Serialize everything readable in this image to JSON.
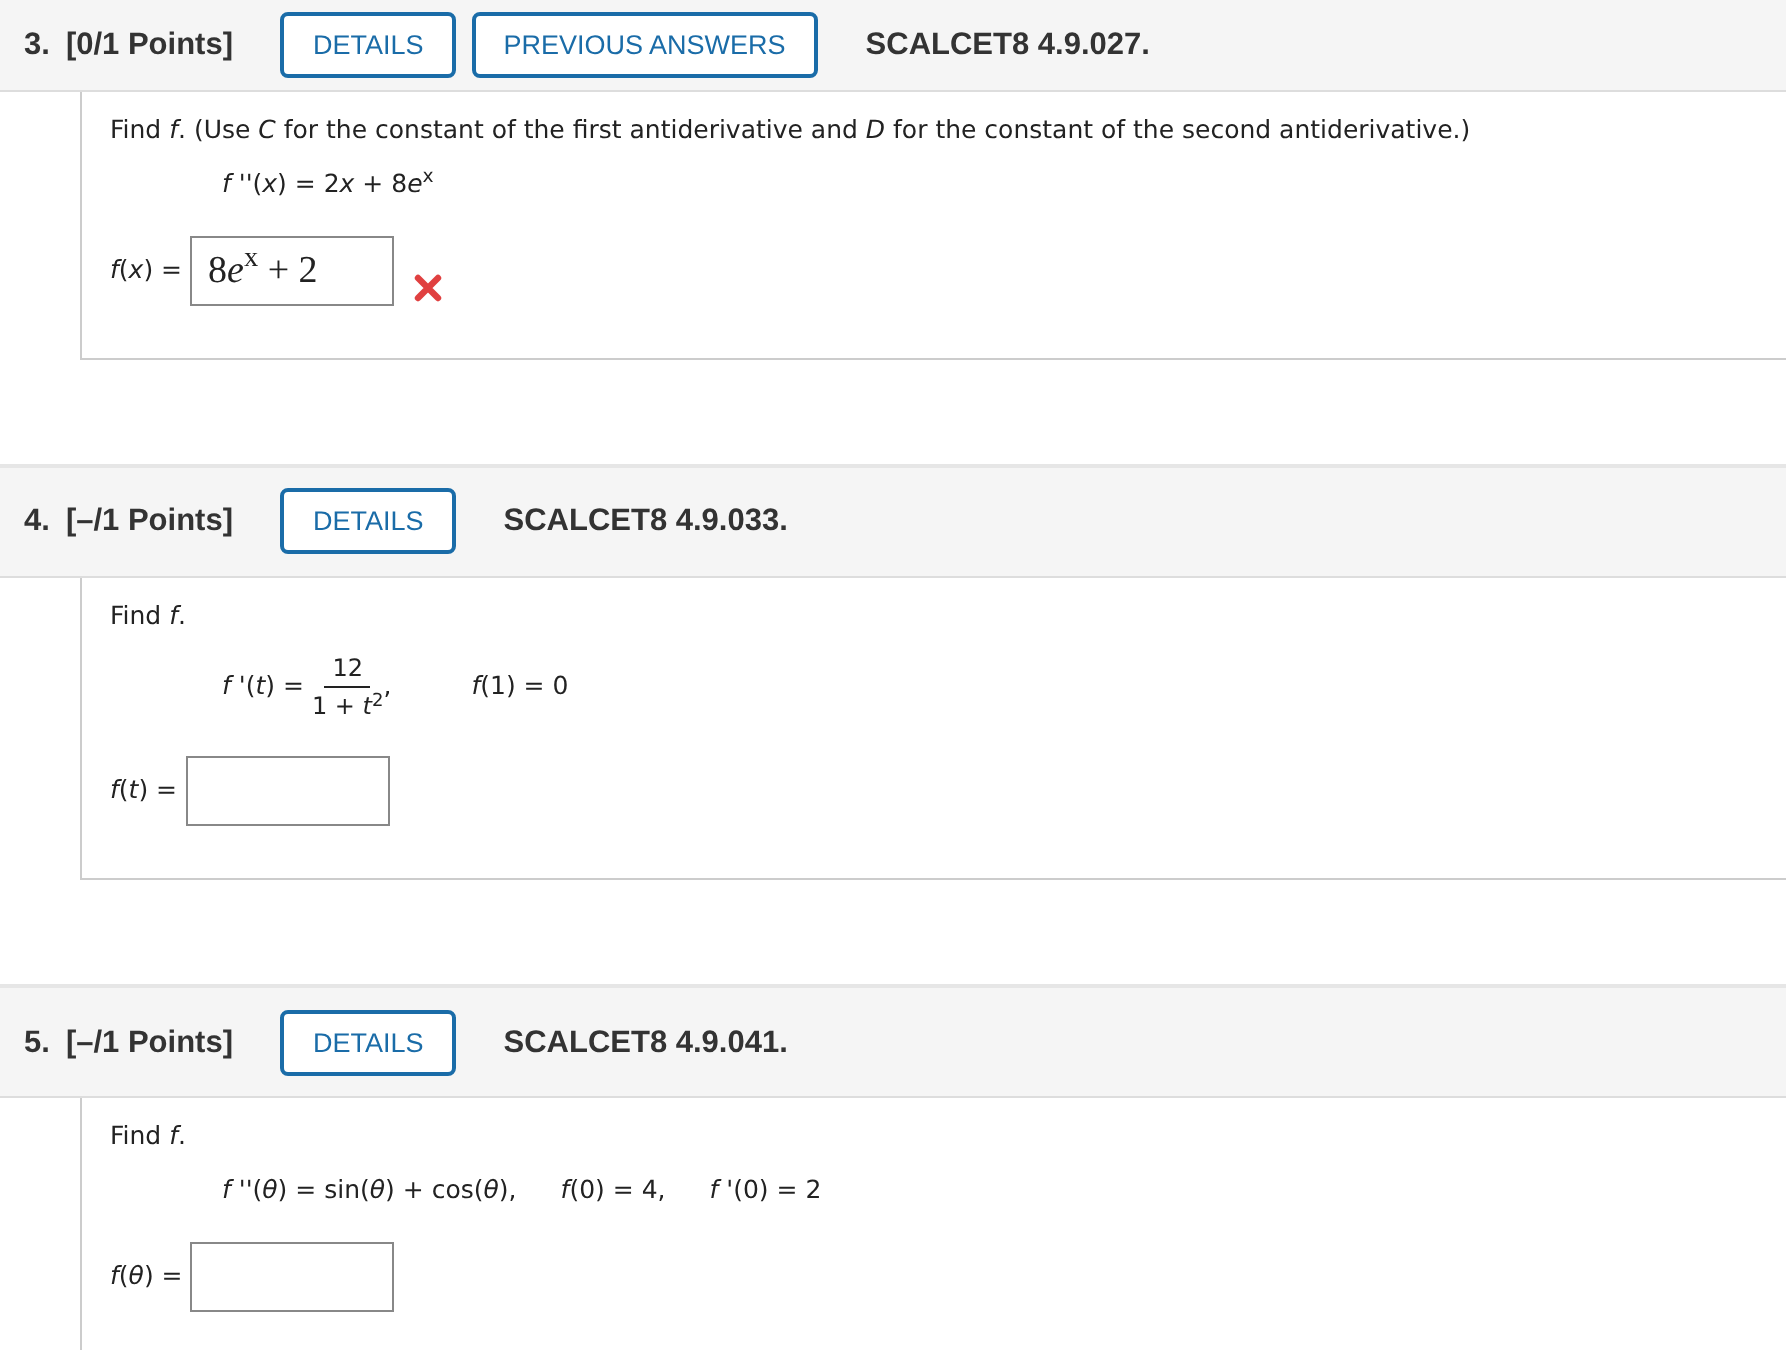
{
  "questions": [
    {
      "number": "3.",
      "points": "[0/1 Points]",
      "buttons": [
        "DETAILS",
        "PREVIOUS ANSWERS"
      ],
      "code": "SCALCET8 4.9.027.",
      "prompt": "Find *f*. (Use *C* for the constant of the first antiderivative and *D* for the constant of the second antiderivative.)",
      "given": [
        {
          "kind": "text",
          "text": [
            "*f* ''(*x*) = 2",
            "*x*",
            " + 8",
            "*e*",
            "$^{x}$"
          ]
        }
      ],
      "answer_label": [
        "*f*(*x*) ="
      ],
      "answer_value": [
        "8",
        "*e*",
        "$^{x}$",
        " + 2"
      ],
      "incorrect": true
    },
    {
      "number": "4.",
      "points": "[–/1 Points]",
      "buttons": [
        "DETAILS"
      ],
      "code": "SCALCET8 4.9.033.",
      "prompt": "Find *f*.",
      "given": [
        {
          "kind": "text",
          "text": [
            "*f* '(*t*) ="
          ]
        },
        {
          "kind": "fraction",
          "numerator": "12",
          "denominator": [
            "1 + ",
            "*t*",
            "$^{2}$"
          ]
        },
        {
          "kind": "text",
          "text": [
            ","
          ]
        },
        {
          "kind": "text",
          "text": [
            "*f*(1) = 0"
          ]
        }
      ],
      "answer_label": [
        "*f*(*t*) ="
      ],
      "incorrect": false
    },
    {
      "number": "5.",
      "points": "[–/1 Points]",
      "buttons": [
        "DETAILS"
      ],
      "code": "SCALCET8 4.9.041.",
      "prompt": "Find *f*.",
      "given": [
        {
          "kind": "text",
          "text": [
            "*f* ''(*θ*) = sin(*θ*) + cos(*θ*),"
          ]
        },
        {
          "kind": "text",
          "text": [
            "*f*(0) = 4,"
          ]
        },
        {
          "kind": "text",
          "text": [
            "*f* '(0) = 2"
          ]
        }
      ],
      "answer_label": [
        "*f*(*θ*) ="
      ],
      "incorrect": false
    }
  ]
}
